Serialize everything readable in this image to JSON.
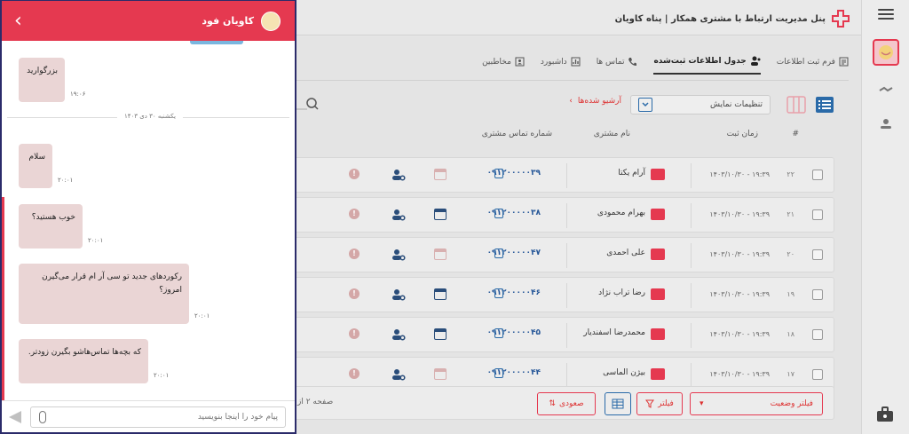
{
  "header": {
    "title": "پنل مدیریت ارتباط با مشتری همکار | پناه کاویان"
  },
  "tabs": [
    {
      "label": "فرم ثبت اطلاعات",
      "icon": "form-icon",
      "active": false
    },
    {
      "label": "جدول اطلاعات ثبت‌شده",
      "icon": "users-icon",
      "active": true
    },
    {
      "label": "تماس ها",
      "icon": "phone-icon",
      "active": false
    },
    {
      "label": "داشبورد",
      "icon": "chart-icon",
      "active": false
    },
    {
      "label": "مخاطبین",
      "icon": "contact-icon",
      "active": false
    }
  ],
  "toolbar": {
    "display_settings": "تنظیمات نمایش",
    "archived": "آرشیو شده‌ها"
  },
  "table": {
    "headers": {
      "index": "#",
      "time": "زمان ثبت",
      "name": "نام مشتری",
      "phone": "شماره تماس مشتری"
    },
    "rows": [
      {
        "num": "۲۲",
        "time": "۱۴۰۳/۱۰/۳۰ - ۱۹:۳۹",
        "name": "آرام یکتا",
        "phone": "۰۹۱۲۰۰۰۰۰۳۹",
        "calendar_active": false
      },
      {
        "num": "۲۱",
        "time": "۱۴۰۳/۱۰/۳۰ - ۱۹:۳۹",
        "name": "بهرام محمودی",
        "phone": "۰۹۱۲۰۰۰۰۰۳۸",
        "calendar_active": true
      },
      {
        "num": "۲۰",
        "time": "۱۴۰۳/۱۰/۳۰ - ۱۹:۳۹",
        "name": "علی احمدی",
        "phone": "۰۹۱۲۰۰۰۰۰۴۷",
        "calendar_active": false
      },
      {
        "num": "۱۹",
        "time": "۱۴۰۳/۱۰/۳۰ - ۱۹:۳۹",
        "name": "رضا تراب نژاد",
        "phone": "۰۹۱۲۰۰۰۰۰۴۶",
        "calendar_active": true
      },
      {
        "num": "۱۸",
        "time": "۱۴۰۳/۱۰/۳۰ - ۱۹:۳۹",
        "name": "محمدرضا اسفندیار",
        "phone": "۰۹۱۲۰۰۰۰۰۴۵",
        "calendar_active": true
      },
      {
        "num": "۱۷",
        "time": "۱۴۰۳/۱۰/۳۰ - ۱۹:۳۹",
        "name": "بیژن الماسی",
        "phone": "۰۹۱۲۰۰۰۰۰۴۴",
        "calendar_active": false
      }
    ]
  },
  "bottom": {
    "status_filter": "فیلتر وضعیت",
    "filter": "فیلتر",
    "sort": "صعودی",
    "page_info": "صفحه ۲ از"
  },
  "chat": {
    "name": "کاویان فود",
    "day_label": "یکشنبه ۳۰ دی ۱۴۰۳",
    "messages": [
      {
        "text": "بزرگوارید",
        "time": "۱۹:۰۶"
      },
      {
        "text": "سلام",
        "time": "۲۰:۰۱"
      },
      {
        "text": "خوب هستید؟",
        "time": "۲۰:۰۱"
      },
      {
        "text": "رکوردهای جدید تو سی آر ام قرار می‌گیرن امروز؟",
        "time": "۲۰:۰۱"
      },
      {
        "text": "که بچه‌ها تماس‌هاشو بگیرن زودتر.",
        "time": "۲۰:۰۱"
      }
    ],
    "input_placeholder": "پیام خود را اینجا بنویسید"
  },
  "colors": {
    "accent": "#e53950",
    "link": "#2a6aa8",
    "chat_bubble": "#ead5d5"
  }
}
